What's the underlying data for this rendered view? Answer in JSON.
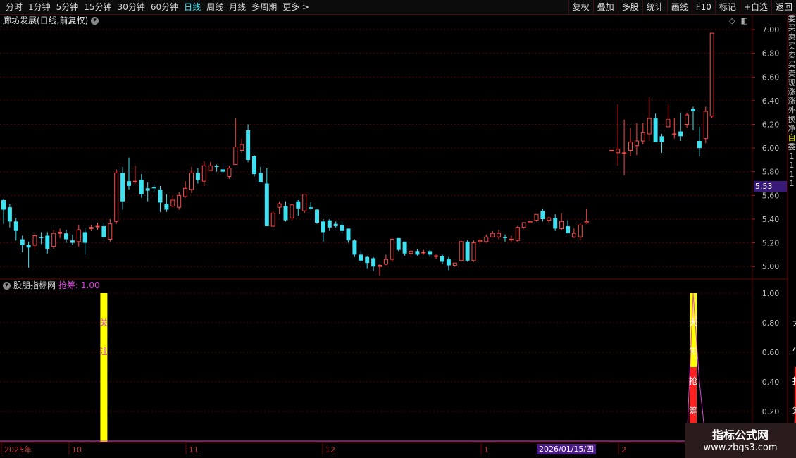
{
  "toolbar": {
    "periods": [
      "分时",
      "1分钟",
      "5分钟",
      "15分钟",
      "30分钟",
      "60分钟",
      "日线",
      "周线",
      "月线",
      "多周期",
      "更多 >"
    ],
    "active_period": "日线",
    "tools": [
      "复权",
      "叠加",
      "多股",
      "统计",
      "画线",
      "F10",
      "标记",
      "+自选",
      "返回"
    ]
  },
  "chart": {
    "title": "廊坊发展(日线,前复权)",
    "price_axis": [
      "7.00",
      "6.80",
      "6.60",
      "6.40",
      "6.20",
      "6.00",
      "5.80",
      "5.60",
      "5.40",
      "5.20",
      "5.00"
    ],
    "current_price_label": "5.53",
    "candles": [
      [
        5.56,
        5.48,
        5.57,
        5.36
      ],
      [
        5.5,
        5.38,
        5.53,
        5.33
      ],
      [
        5.38,
        5.3,
        5.41,
        5.22
      ],
      [
        5.23,
        5.18,
        5.26,
        5.12
      ],
      [
        5.18,
        5.16,
        5.21,
        4.99
      ],
      [
        5.18,
        5.26,
        5.28,
        5.14
      ],
      [
        5.25,
        5.24,
        5.29,
        5.19
      ],
      [
        5.26,
        5.15,
        5.29,
        5.11
      ],
      [
        5.17,
        5.28,
        5.31,
        5.15
      ],
      [
        5.28,
        5.29,
        5.32,
        5.24
      ],
      [
        5.28,
        5.23,
        5.31,
        5.2
      ],
      [
        5.22,
        5.2,
        5.27,
        5.18
      ],
      [
        5.21,
        5.31,
        5.35,
        5.17
      ],
      [
        5.29,
        5.2,
        5.32,
        5.1
      ],
      [
        5.32,
        5.33,
        5.35,
        5.3
      ],
      [
        5.34,
        5.34,
        5.37,
        5.31
      ],
      [
        5.34,
        5.25,
        5.37,
        5.23
      ],
      [
        5.23,
        5.36,
        5.4,
        5.21
      ],
      [
        5.38,
        5.79,
        5.82,
        5.36
      ],
      [
        5.79,
        5.55,
        5.84,
        5.48
      ],
      [
        5.72,
        5.68,
        5.92,
        5.65
      ],
      [
        5.72,
        5.72,
        5.85,
        5.7
      ],
      [
        5.73,
        5.61,
        5.78,
        5.58
      ],
      [
        5.66,
        5.64,
        5.71,
        5.55
      ],
      [
        5.67,
        5.66,
        5.69,
        5.63
      ],
      [
        5.65,
        5.54,
        5.68,
        5.46
      ],
      [
        5.53,
        5.48,
        5.61,
        5.46
      ],
      [
        5.51,
        5.56,
        5.6,
        5.5
      ],
      [
        5.5,
        5.6,
        5.63,
        5.48
      ],
      [
        5.59,
        5.66,
        5.72,
        5.58
      ],
      [
        5.65,
        5.79,
        5.84,
        5.62
      ],
      [
        5.79,
        5.73,
        5.83,
        5.7
      ],
      [
        5.72,
        5.85,
        5.89,
        5.68
      ],
      [
        5.81,
        5.85,
        5.88,
        5.81
      ],
      [
        5.85,
        5.84,
        5.86,
        5.8
      ],
      [
        5.82,
        5.8,
        5.87,
        5.79
      ],
      [
        5.76,
        5.83,
        5.85,
        5.74
      ],
      [
        5.86,
        6.01,
        6.25,
        5.86
      ],
      [
        5.98,
        6.03,
        6.08,
        5.96
      ],
      [
        6.15,
        5.9,
        6.2,
        5.88
      ],
      [
        5.93,
        5.78,
        5.94,
        5.76
      ],
      [
        5.79,
        5.71,
        5.84,
        5.72
      ],
      [
        5.7,
        5.34,
        5.83,
        5.34
      ],
      [
        5.34,
        5.45,
        5.47,
        5.38
      ],
      [
        5.5,
        5.53,
        5.55,
        5.44
      ],
      [
        5.51,
        5.39,
        5.55,
        5.38
      ],
      [
        5.41,
        5.52,
        5.53,
        5.39
      ],
      [
        5.55,
        5.49,
        5.56,
        5.43
      ],
      [
        5.47,
        5.61,
        5.61,
        5.45
      ],
      [
        5.5,
        5.49,
        5.54,
        5.48
      ],
      [
        5.48,
        5.37,
        5.49,
        5.36
      ],
      [
        5.38,
        5.29,
        5.4,
        5.21
      ],
      [
        5.39,
        5.33,
        5.4,
        5.3
      ],
      [
        5.36,
        5.34,
        5.38,
        5.33
      ],
      [
        5.35,
        5.3,
        5.38,
        5.28
      ],
      [
        5.32,
        5.22,
        5.32,
        5.2
      ],
      [
        5.22,
        5.1,
        5.23,
        5.08
      ],
      [
        5.1,
        5.05,
        5.13,
        5.04
      ],
      [
        5.08,
        5.03,
        5.09,
        4.98
      ],
      [
        5.07,
        5.0,
        5.08,
        4.96
      ],
      [
        5.0,
        5.01,
        5.02,
        4.92
      ],
      [
        5.02,
        5.06,
        5.1,
        5.01
      ],
      [
        5.06,
        5.23,
        5.23,
        5.04
      ],
      [
        5.24,
        5.14,
        5.24,
        5.13
      ],
      [
        5.21,
        5.11,
        5.21,
        5.09
      ],
      [
        5.11,
        5.13,
        5.14,
        5.08
      ],
      [
        5.13,
        5.1,
        5.15,
        5.09
      ],
      [
        5.12,
        5.12,
        5.14,
        5.1
      ],
      [
        5.13,
        5.1,
        5.14,
        5.08
      ],
      [
        5.09,
        5.09,
        5.1,
        5.06
      ],
      [
        5.09,
        5.04,
        5.1,
        5.02
      ],
      [
        5.06,
        5.01,
        5.08,
        4.97
      ],
      [
        5.01,
        5.03,
        5.03,
        5.0
      ],
      [
        5.05,
        5.21,
        5.22,
        5.04
      ],
      [
        5.21,
        5.05,
        5.22,
        5.04
      ],
      [
        5.05,
        5.2,
        5.22,
        5.04
      ],
      [
        5.21,
        5.22,
        5.24,
        5.19
      ],
      [
        5.21,
        5.25,
        5.27,
        5.2
      ],
      [
        5.25,
        5.28,
        5.3,
        5.25
      ],
      [
        5.25,
        5.28,
        5.31,
        5.23
      ],
      [
        5.25,
        5.24,
        5.27,
        5.21
      ],
      [
        5.23,
        5.23,
        5.26,
        5.21
      ],
      [
        5.22,
        5.33,
        5.34,
        5.21
      ],
      [
        5.33,
        5.37,
        5.37,
        5.32
      ],
      [
        5.37,
        5.38,
        5.38,
        5.37
      ],
      [
        5.39,
        5.44,
        5.44,
        5.38
      ],
      [
        5.47,
        5.4,
        5.49,
        5.38
      ],
      [
        5.39,
        5.41,
        5.42,
        5.37
      ],
      [
        5.41,
        5.32,
        5.44,
        5.3
      ],
      [
        5.32,
        5.38,
        5.45,
        5.31
      ],
      [
        5.34,
        5.28,
        5.39,
        5.28
      ],
      [
        5.25,
        5.28,
        5.32,
        5.24
      ],
      [
        5.25,
        5.35,
        5.36,
        5.22
      ],
      [
        5.37,
        5.38,
        5.49,
        5.36
      ],
      null,
      null,
      null,
      [
        5.98,
        5.98,
        5.98,
        5.98
      ],
      [
        5.96,
        5.99,
        6.37,
        5.85
      ],
      [
        5.96,
        5.96,
        6.24,
        5.77
      ],
      [
        5.98,
        6.05,
        6.17,
        5.93
      ],
      [
        6.02,
        6.06,
        6.21,
        5.94
      ],
      [
        6.06,
        6.13,
        6.21,
        6.03
      ],
      [
        6.12,
        6.25,
        6.43,
        6.06
      ],
      [
        6.25,
        6.05,
        6.29,
        6.05
      ],
      [
        6.1,
        6.05,
        6.12,
        5.96
      ],
      [
        6.18,
        6.24,
        6.37,
        6.17
      ],
      [
        6.12,
        6.12,
        6.25,
        6.08
      ],
      [
        6.14,
        6.1,
        6.3,
        6.06
      ],
      [
        6.2,
        6.28,
        6.3,
        6.17
      ],
      [
        6.33,
        6.31,
        6.35,
        6.15
      ],
      [
        6.06,
        6.0,
        6.18,
        5.93
      ],
      [
        6.08,
        6.31,
        6.35,
        6.04
      ],
      [
        6.27,
        6.97,
        6.97,
        6.25
      ]
    ],
    "candle_price_range": [
      4.9,
      7.03
    ]
  },
  "indicator": {
    "name": "股朋指标网",
    "param": "抢筹: 1.00",
    "axis": [
      "1.00",
      "0.80",
      "0.60",
      "0.40",
      "0.20"
    ],
    "signal_text_1": [
      "关",
      "注"
    ],
    "signal_text_2": [
      "大",
      "牛",
      "抢",
      "筹"
    ],
    "signal_text_3": [
      "大",
      "牛",
      "抢",
      "筹"
    ],
    "bars": [
      {
        "index": 16,
        "color": "#ffff00",
        "value": 1.0
      },
      {
        "index": 110,
        "color": "#ffff00",
        "value": 1.0
      },
      {
        "index": 110,
        "color": "#ff2020",
        "value": 0.5
      }
    ]
  },
  "time_axis": [
    "2025年",
    "10",
    "11",
    "12",
    "1",
    "2026/01/15/四",
    "2"
  ],
  "side_strip": [
    "委",
    "买",
    "卖",
    "买",
    "卖",
    "买",
    "卖",
    "现",
    "涨",
    "涨",
    "外",
    "换",
    "净",
    "自",
    "委",
    "1",
    "1",
    "1",
    "1"
  ],
  "watermark": {
    "title": "指标公式网",
    "url": "www.zbgs3.com"
  },
  "colors": {
    "up": "#ff4a4a",
    "down": "#3fe0f0",
    "grid": "#5a0000",
    "accent": "#e040e0"
  }
}
